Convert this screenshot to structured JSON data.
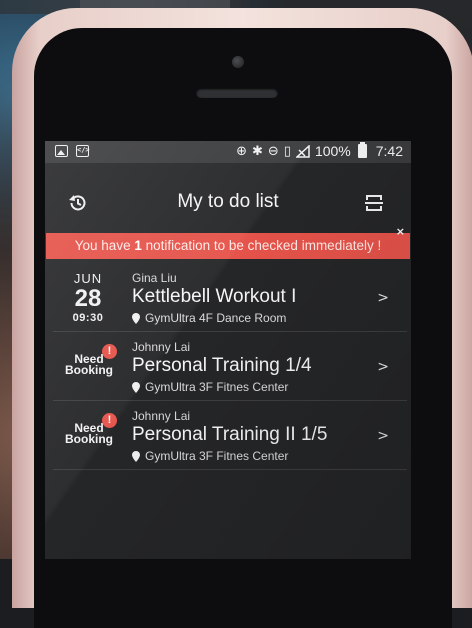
{
  "status_bar": {
    "battery": "100%",
    "time": "7:42",
    "left_icons": [
      "image-icon",
      "code-icon"
    ],
    "right_icons": [
      "data-saver-icon",
      "bluetooth-icon",
      "do-not-disturb-icon",
      "no-sim-icon",
      "signal-icon",
      "battery-icon"
    ]
  },
  "header": {
    "title": "My to do list",
    "left_icon": "history-icon",
    "right_icon": "scan-icon"
  },
  "notification": {
    "prefix": "You have ",
    "count": "1",
    "suffix": " notification to be checked immediately !",
    "close": "×",
    "color": "#e5534a"
  },
  "items": [
    {
      "month": "JUN",
      "day": "28",
      "time": "09:30",
      "trainer": "Gina Liu",
      "title": "Kettlebell Workout I",
      "location": "GymUltra 4F Dance Room",
      "arrow": ">"
    },
    {
      "status_line1": "Need",
      "status_line2": "Booking",
      "badge": "!",
      "trainer": "Johnny Lai",
      "title": "Personal Training 1/4",
      "location": "GymUltra 3F Fitnes Center",
      "arrow": ">"
    },
    {
      "status_line1": "Need",
      "status_line2": "Booking",
      "badge": "!",
      "trainer": "Johnny Lai",
      "title": "Personal Training II 1/5",
      "location": "GymUltra 3F Fitnes Center",
      "arrow": ">"
    }
  ]
}
